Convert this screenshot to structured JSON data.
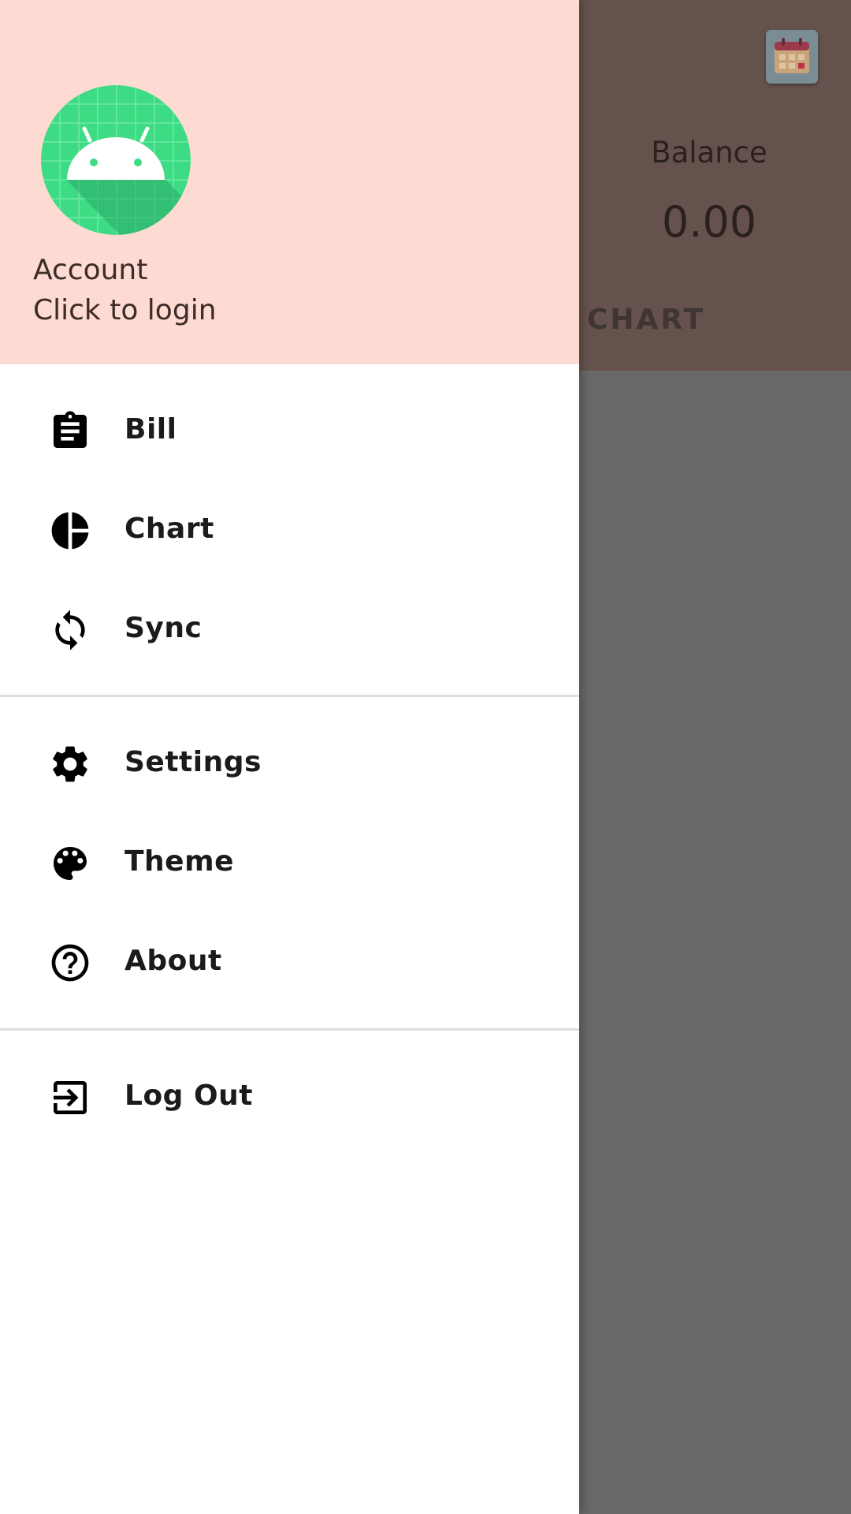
{
  "app": {
    "balance_label": "Balance",
    "balance_value": "0.00",
    "tab_chart": "CHART",
    "calendar_icon": "calendar-icon"
  },
  "drawer": {
    "header": {
      "avatar_icon": "android-avatar-icon",
      "title": "Account",
      "subtitle": "Click to login",
      "background": "#fddbd3"
    },
    "groups": [
      [
        {
          "label": "Bill",
          "icon": "clipboard-icon"
        },
        {
          "label": "Chart",
          "icon": "pie-chart-icon"
        },
        {
          "label": "Sync",
          "icon": "sync-icon"
        }
      ],
      [
        {
          "label": "Settings",
          "icon": "gear-icon"
        },
        {
          "label": "Theme",
          "icon": "palette-icon"
        },
        {
          "label": "About",
          "icon": "help-icon"
        }
      ],
      [
        {
          "label": "Log Out",
          "icon": "exit-icon"
        }
      ]
    ]
  },
  "colors": {
    "scrim": "#686868",
    "drawer_header": "#fddbd3",
    "avatar_green": "#3ddc84",
    "text_primary": "#1b1b1b"
  }
}
